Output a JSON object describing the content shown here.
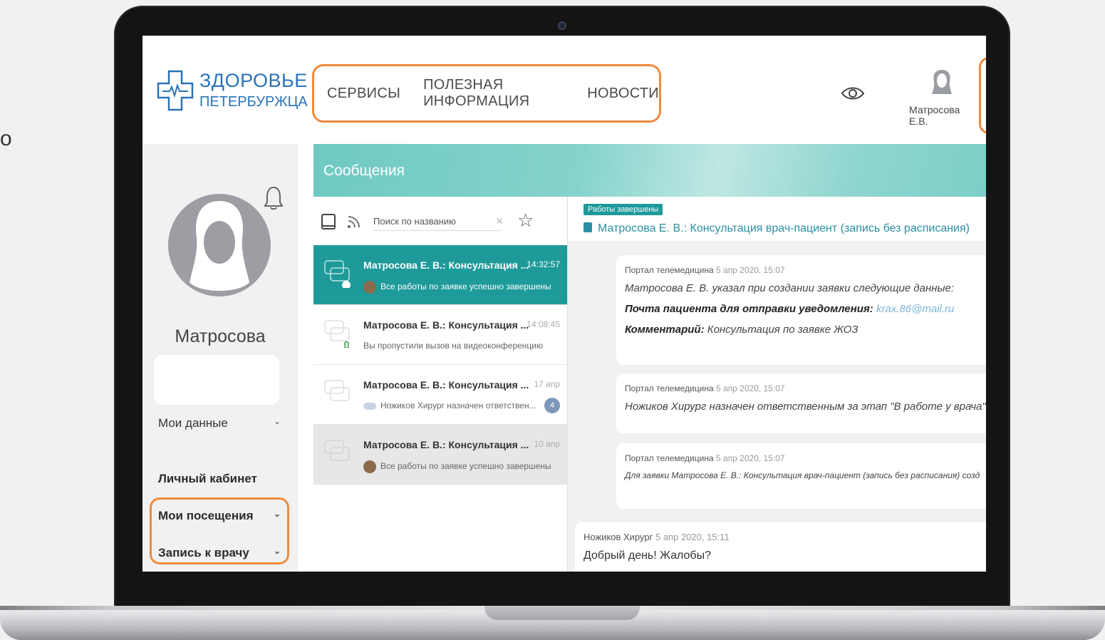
{
  "edge_text": "о",
  "header": {
    "logo_line1": "ЗДОРОВЬЕ",
    "logo_line2": "ПЕТЕРБУРЖЦА",
    "nav": [
      "СЕРВИСЫ",
      "ПОЛЕЗНАЯ ИНФОРМАЦИЯ",
      "НОВОСТИ"
    ],
    "user_name": "Матросова Е.В."
  },
  "sidebar": {
    "profile_name": "Матросова",
    "my_data": "Мои данные",
    "cabinet": "Личный кабинет",
    "visits": "Мои посещения",
    "appointment": "Запись к врачу"
  },
  "messages_title": "Сообщения",
  "search": {
    "placeholder": "Поиск по названию"
  },
  "conversations": [
    {
      "title": "Матросова Е. В.: Консультация ...",
      "time": "14:32:57",
      "preview": "Все работы по заявке успешно завершены"
    },
    {
      "title": "Матросова Е. В.: Консультация ...",
      "time": "14:08:45",
      "preview": "Вы пропустили вызов на видеоконференцию"
    },
    {
      "title": "Матросова Е. В.: Консультация ...",
      "time": "17 апр",
      "preview": "Ножиков Хирург назначен ответствен...",
      "badge": "4"
    },
    {
      "title": "Матросова Е. В.: Консультация ...",
      "time": "10 апр",
      "preview": "Все работы по заявке успешно завершены"
    }
  ],
  "chat": {
    "status": "Работы завершены",
    "title": "Матросова Е. В.: Консультация врач-пациент (запись без расписания)",
    "messages": [
      {
        "author": "Портал телемедицина",
        "date": "5 апр 2020, 15:07",
        "line1": "Матросова Е. В. указал при создании заявки следующие данные:",
        "email_label": "Почта пациента для отправки уведомления:",
        "email": "krax.86@mail.ru",
        "comment_label": "Комментарий:",
        "comment": "Консультация по заявке ЖОЗ"
      },
      {
        "author": "Портал телемедицина",
        "date": "5 апр 2020, 15:07",
        "text": "Ножиков Хирург назначен ответственным за этап \"В работе у врача\""
      },
      {
        "author": "Портал телемедицина",
        "date": "5 апр 2020, 15:07",
        "text": "Для заявки Матросова Е. В.: Консультация врач-пациент (запись без расписания) созд"
      }
    ],
    "reply": {
      "author": "Ножиков Хирург",
      "date": "5 апр 2020, 15:11",
      "text": "Добрый день! Жалобы?"
    }
  },
  "colors": {
    "accent": "#1f9a9a",
    "highlight": "#ef8a3c",
    "brand": "#2a73b8"
  }
}
